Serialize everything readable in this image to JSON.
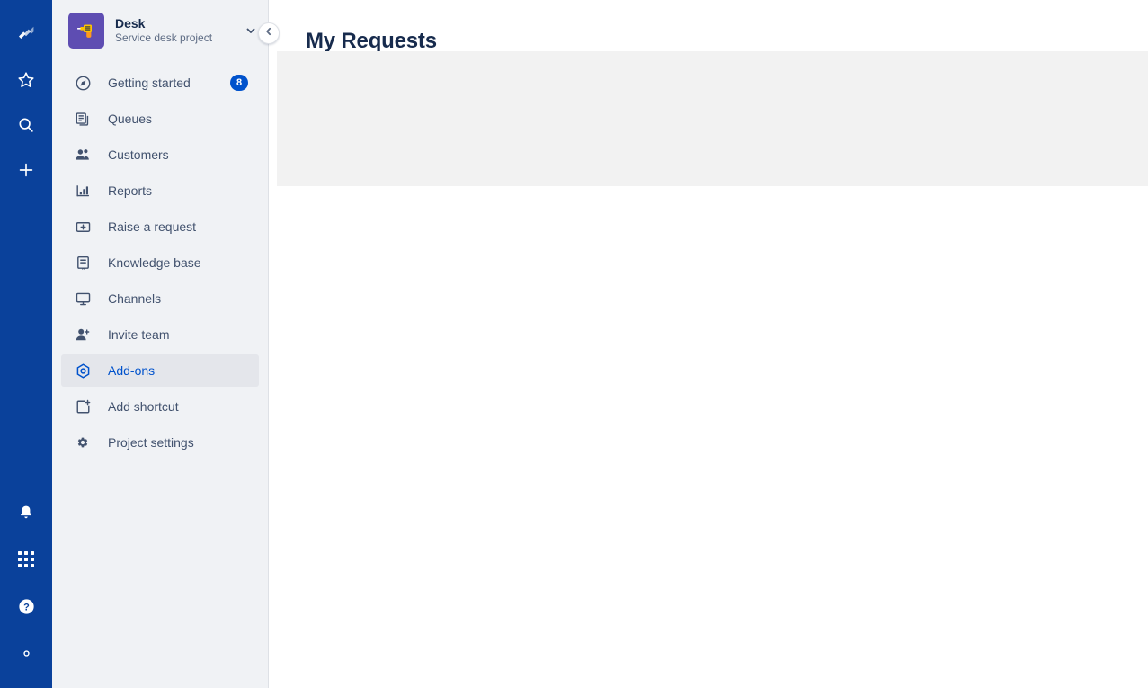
{
  "rail": {
    "top_items": [
      {
        "name": "jira-logo",
        "label": "Jira"
      },
      {
        "name": "starred-icon",
        "label": "Starred"
      },
      {
        "name": "search-icon",
        "label": "Search"
      },
      {
        "name": "create-icon",
        "label": "Create"
      }
    ],
    "bottom_items": [
      {
        "name": "notifications-icon",
        "label": "Notifications"
      },
      {
        "name": "app-switcher-icon",
        "label": "App switcher"
      },
      {
        "name": "help-icon",
        "label": "Help"
      },
      {
        "name": "settings-icon",
        "label": "Settings"
      }
    ],
    "background_color": "#0A419B"
  },
  "sidebar": {
    "project": {
      "name": "Desk",
      "type": "Service desk project",
      "avatar_icon": "drill-icon",
      "avatar_color": "#5E4DB2",
      "switcher_icon": "chevron-down-icon"
    },
    "collapse_button": {
      "name": "collapse-sidebar-button",
      "icon": "chevron-left-icon"
    },
    "items": [
      {
        "label": "Getting started",
        "icon": "compass-icon",
        "badge": "8",
        "selected": false
      },
      {
        "label": "Queues",
        "icon": "queues-icon",
        "badge": "",
        "selected": false
      },
      {
        "label": "Customers",
        "icon": "customers-icon",
        "badge": "",
        "selected": false
      },
      {
        "label": "Reports",
        "icon": "reports-icon",
        "badge": "",
        "selected": false
      },
      {
        "label": "Raise a request",
        "icon": "raise-request-icon",
        "badge": "",
        "selected": false
      },
      {
        "label": "Knowledge base",
        "icon": "knowledge-base-icon",
        "badge": "",
        "selected": false
      },
      {
        "label": "Channels",
        "icon": "channels-icon",
        "badge": "",
        "selected": false
      },
      {
        "label": "Invite team",
        "icon": "invite-team-icon",
        "badge": "",
        "selected": false
      },
      {
        "label": "Add-ons",
        "icon": "addons-icon",
        "badge": "",
        "selected": true
      },
      {
        "label": "Add shortcut",
        "icon": "add-shortcut-icon",
        "badge": "",
        "selected": false
      },
      {
        "label": "Project settings",
        "icon": "project-settings-icon",
        "badge": "",
        "selected": false
      }
    ],
    "background_color": "#F0F2F5",
    "selected_background": "#E4E6EB",
    "selected_text_color": "#0052CC"
  },
  "main": {
    "title": "My Requests",
    "panel_color": "#F2F2F2"
  }
}
